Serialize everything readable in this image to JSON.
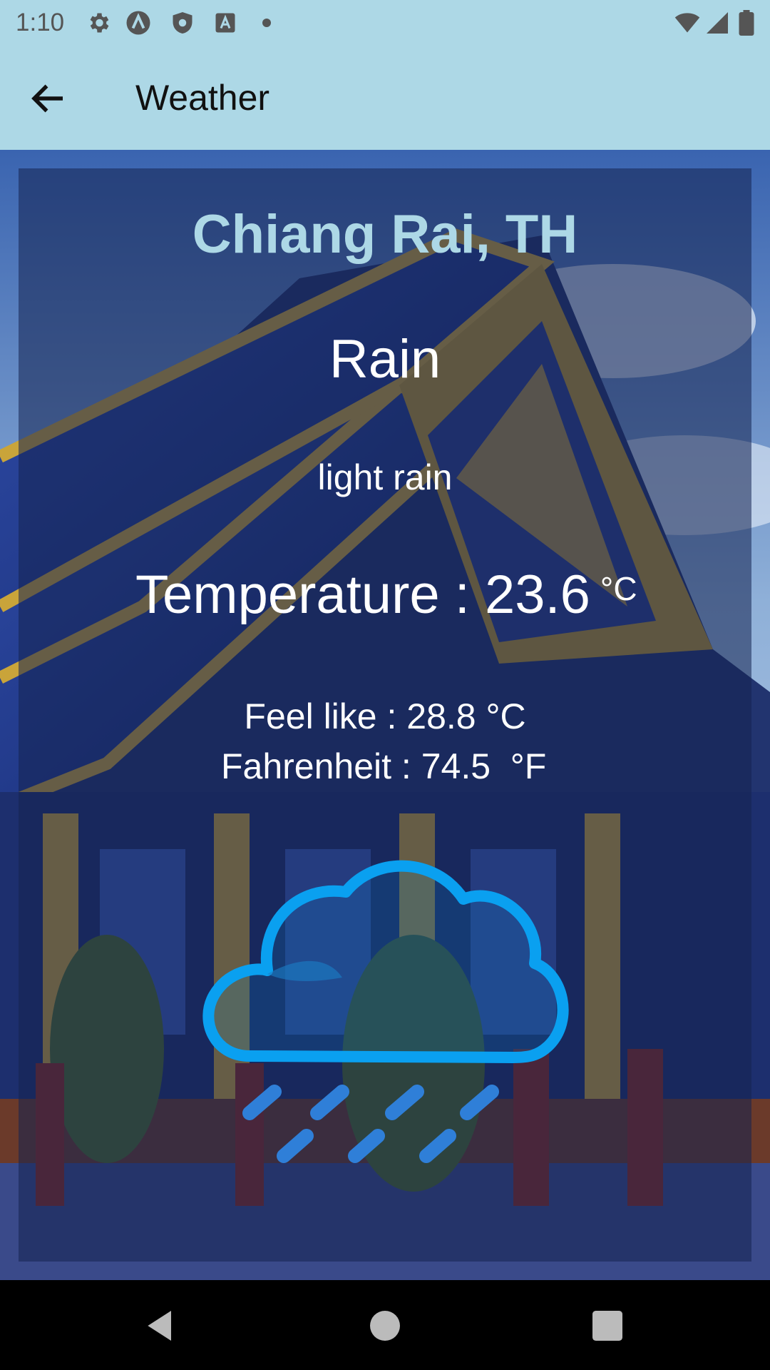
{
  "status_bar": {
    "time": "1:10",
    "left_icons": [
      "settings-icon",
      "a-circle-icon",
      "shield-icon",
      "a-box-icon",
      "dot-icon"
    ],
    "right_icons": [
      "wifi-icon",
      "signal-icon",
      "battery-icon"
    ]
  },
  "app_bar": {
    "title": "Weather",
    "back_icon": "arrow-back-icon",
    "background": "#add8e6"
  },
  "weather": {
    "city": "Chiang Rai, TH",
    "main": "Rain",
    "description": "light rain",
    "temperature_label": "Temperature : 23.6",
    "temperature_unit": "°C",
    "feels_like": "Feel like : 28.8 °C",
    "fahrenheit": "Fahrenheit : 74.5  °F",
    "icon": "rain-cloud-icon",
    "city_color": "#add8e6",
    "icon_cloud_color": "#0aa0f0",
    "icon_rain_color": "#2f7fd8"
  },
  "nav_bar": {
    "buttons": [
      "back-triangle-icon",
      "home-circle-icon",
      "recents-square-icon"
    ]
  }
}
